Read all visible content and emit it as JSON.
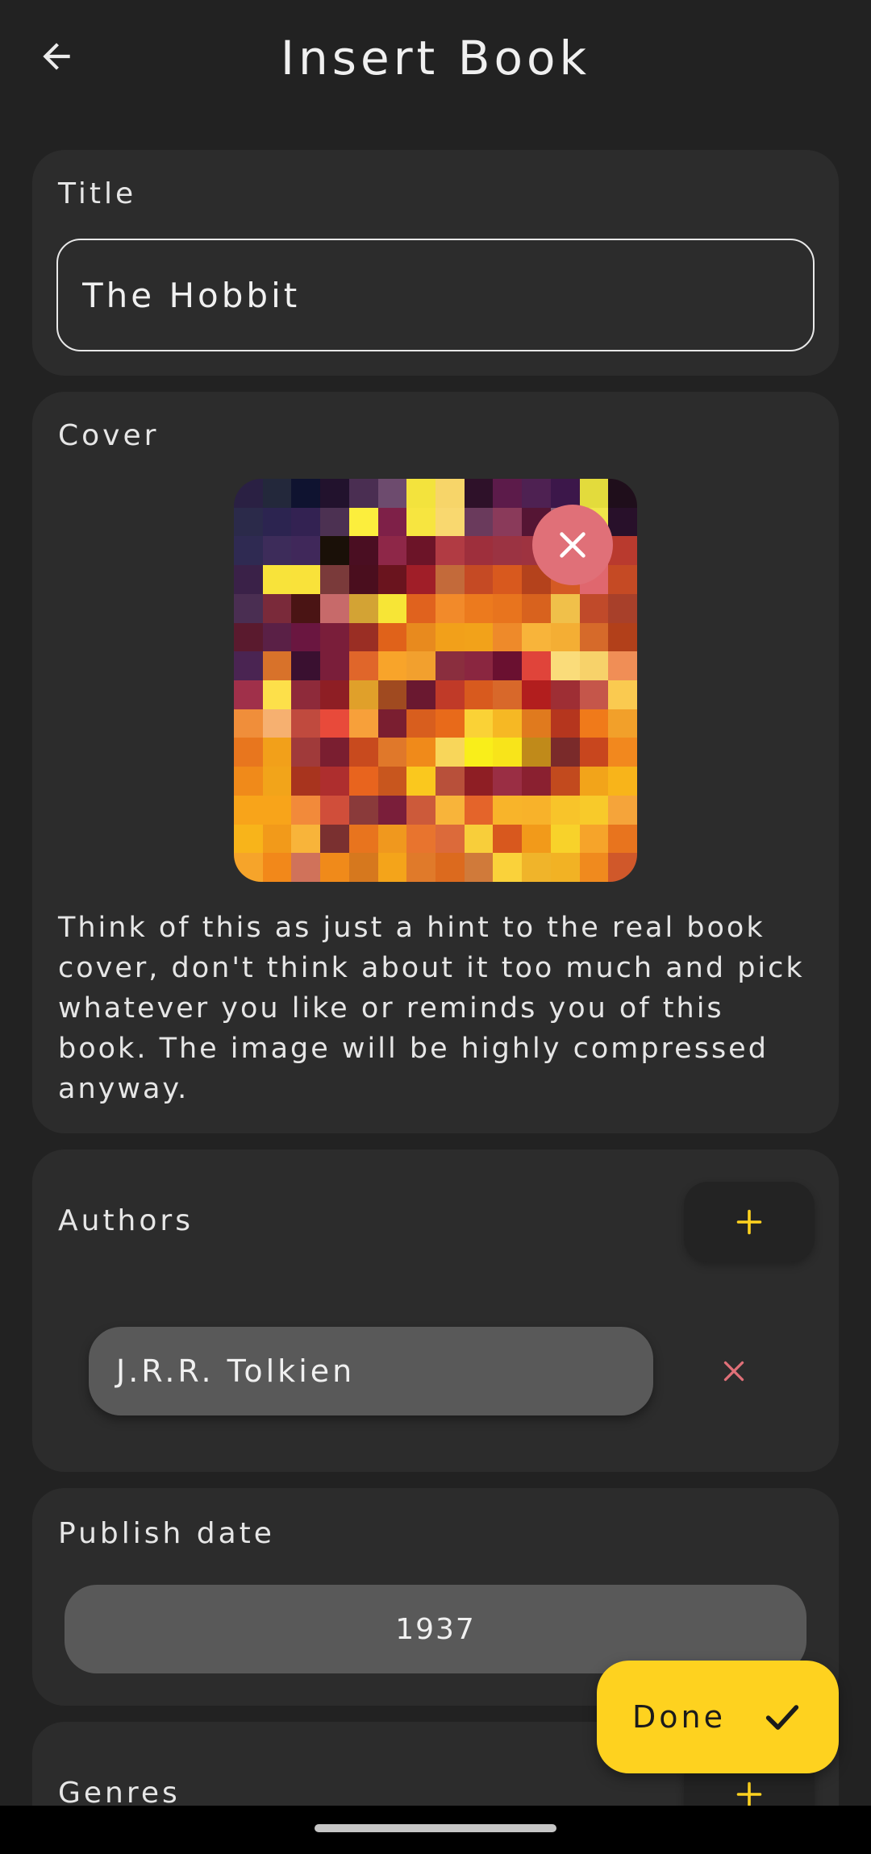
{
  "header": {
    "title": "Insert Book",
    "back_icon": "arrow-left-icon"
  },
  "title_section": {
    "label": "Title",
    "value": "The Hobbit"
  },
  "cover_section": {
    "label": "Cover",
    "hint": "Think of this as just a hint to the real book cover, don't think about it too much and pick whatever you like or reminds you of this book. The image will be highly compressed anyway.",
    "remove_icon": "close-icon",
    "remove_button_color": "#e07078",
    "pixel_palette": [
      "#2a2043",
      "#23283b",
      "#0f1330",
      "#22122d",
      "#4a2e52",
      "#6d4b6e",
      "#f3e33d",
      "#f7d569",
      "#2e1129",
      "#5c1b4a",
      "#4e2152",
      "#3c174a",
      "#e3db3c",
      "#1f0e1b",
      "#2b2a4a",
      "#2c2450",
      "#332252",
      "#4c3152",
      "#fcee3d",
      "#7e2048",
      "#f7e540",
      "#f9d86f",
      "#6a3a5c",
      "#8a3a5a",
      "#551534",
      "#8a5f7a",
      "#f0e54a",
      "#28102a",
      "#2f2a52",
      "#3d2c5a",
      "#40285a",
      "#1a1008",
      "#4a0e22",
      "#8e2748",
      "#6c1428",
      "#b13b43",
      "#9e2f3c",
      "#9b3342",
      "#9e3340",
      "#6e213a",
      "#e06d72",
      "#b93a2e",
      "#3a2148",
      "#f8e33a",
      "#f9e23a",
      "#7a3a3a",
      "#4a0e1e",
      "#6a141e",
      "#a01e28",
      "#c36a3a",
      "#c54a24",
      "#d8591e",
      "#b4421c",
      "#d45a24",
      "#e0676e",
      "#c54a24",
      "#4a2e52",
      "#7a2a3a",
      "#4a1414",
      "#c76a6a",
      "#d3a334",
      "#f7e536",
      "#e0621e",
      "#f28a2a",
      "#ec7a1e",
      "#e8741e",
      "#d8621e",
      "#f0c04a",
      "#c04a2a",
      "#a8402a",
      "#5a1a2e",
      "#5a2046",
      "#6a1640",
      "#7a1e3a",
      "#9a2e24",
      "#e0621a",
      "#e88a1e",
      "#f2a01a",
      "#f2a21a",
      "#ee8a2a",
      "#f8b43a",
      "#f4ae34",
      "#d66a2a",
      "#b2401a",
      "#4a2452",
      "#d8722a",
      "#3a1030",
      "#7a1e3a",
      "#e0662a",
      "#f8a42a",
      "#f2a02e",
      "#8a2e3e",
      "#8a2640",
      "#6a1030",
      "#e0443a",
      "#fadc7a",
      "#f7d26a",
      "#f08e56",
      "#a0304a",
      "#fde04a",
      "#8e2a3a",
      "#8e1e24",
      "#e0a02a",
      "#a04a20",
      "#6a1830",
      "#c03a28",
      "#d85a1e",
      "#d8682a",
      "#b21e1e",
      "#9e2e34",
      "#c5564a",
      "#faca50",
      "#f08e3a",
      "#f6b070",
      "#c04a3e",
      "#e84a3a",
      "#f7a03a",
      "#7a1e30",
      "#d85e1e",
      "#e86a1a",
      "#fad236",
      "#f6b824",
      "#e07a1e",
      "#b5361e",
      "#f07a1a",
      "#f2a02a",
      "#e8761e",
      "#f2a01a",
      "#a03a3a",
      "#7a1e30",
      "#c84a1e",
      "#e0782a",
      "#f08a1a",
      "#f8d65a",
      "#f9ee1a",
      "#f8e41a",
      "#c08a1a",
      "#7a2a2a",
      "#c8461e",
      "#f2881e",
      "#f08a1a",
      "#f2a41a",
      "#a8341e",
      "#ae2e2e",
      "#e8641e",
      "#c8561e",
      "#fac81e",
      "#b8503a",
      "#8e1e24",
      "#9a2e44",
      "#8a2030",
      "#c24a1e",
      "#f2a41a",
      "#f8b41a",
      "#f8a41a",
      "#f8a41a",
      "#f28a3a",
      "#d04e3a",
      "#8a3a3a",
      "#7a1e3a",
      "#cc5a3a",
      "#f8b43a",
      "#e4642a",
      "#f8b42a",
      "#f8b22a",
      "#f8c42a",
      "#f8ca2a",
      "#f5a43a",
      "#f8b41a",
      "#f29a1a",
      "#f8b43a",
      "#7a3030",
      "#e8741e",
      "#f0981e",
      "#e8742e",
      "#dc6a3a",
      "#f8ce3a",
      "#d8581e",
      "#f29a1a",
      "#f8d22a",
      "#f6a42a",
      "#e8741e",
      "#f6a42a",
      "#f2881a",
      "#d0725a",
      "#f08a1a",
      "#d6781e",
      "#f4a41a",
      "#e07a2a",
      "#dc6a1e",
      "#d07a3a",
      "#fad23a",
      "#f0b42a",
      "#f2b224",
      "#f08a1e",
      "#d0582a"
    ]
  },
  "authors_section": {
    "label": "Authors",
    "add_icon": "plus-icon",
    "accent_color": "#fed21f",
    "items": [
      {
        "name": "J.R.R. Tolkien",
        "remove_icon": "close-icon"
      }
    ]
  },
  "publish_date_section": {
    "label": "Publish date",
    "value": "1937"
  },
  "genres_section": {
    "label": "Genres",
    "add_icon": "plus-icon"
  },
  "fab": {
    "label": "Done",
    "icon": "check-icon",
    "color": "#fed21f"
  }
}
